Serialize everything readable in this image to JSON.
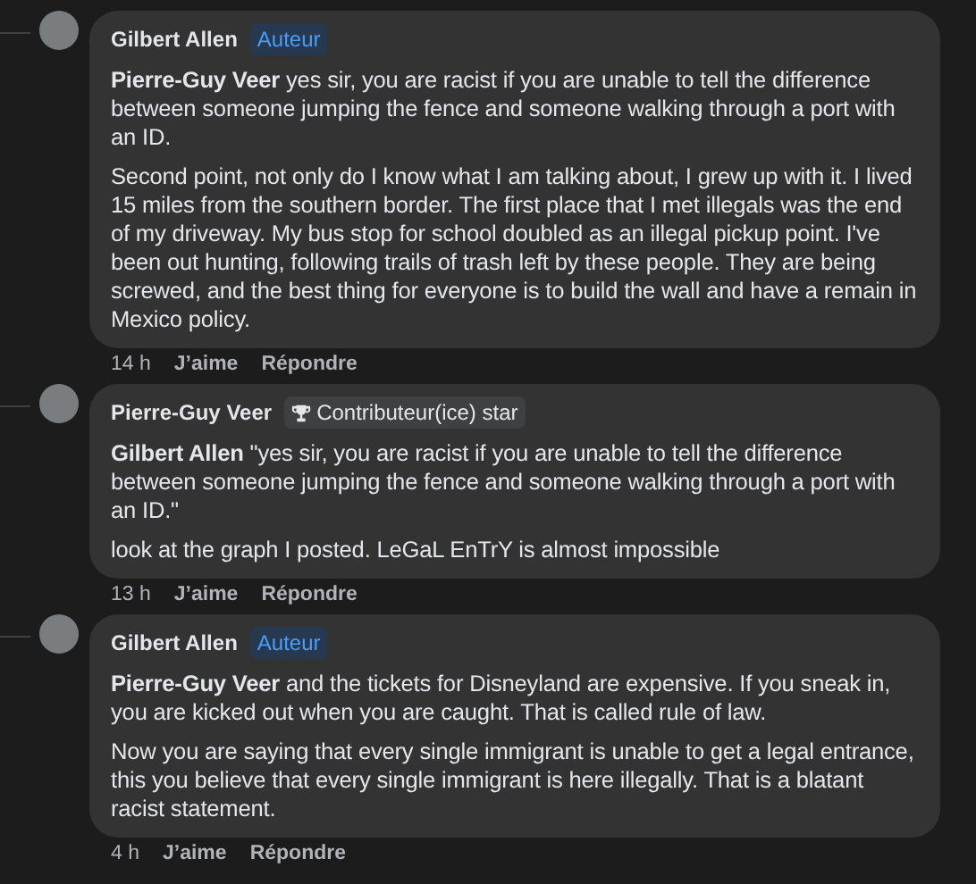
{
  "comments": [
    {
      "author": "Gilbert Allen",
      "badge": {
        "kind": "author",
        "label": "Auteur"
      },
      "paragraphs": [
        "**Pierre-Guy Veer** yes sir, you are racist if you are unable to tell the difference between someone jumping the fence and someone walking through a port with an ID.",
        "Second point, not only do I know what I am talking about, I grew up with it. I lived 15 miles from the southern border. The first place that I met illegals was the end of my driveway. My bus stop for school doubled as an illegal pickup point. I've been out hunting, following trails of trash left by these people. They are being screwed, and the best thing for everyone is to build the wall and have a remain in Mexico policy."
      ],
      "time": "14 h",
      "like": "J’aime",
      "reply": "Répondre"
    },
    {
      "author": "Pierre-Guy Veer",
      "badge": {
        "kind": "contributor",
        "label": "Contributeur(ice) star"
      },
      "paragraphs": [
        "**Gilbert Allen** \"yes sir, you are racist if you are unable to tell the difference between someone jumping the fence and someone walking through a port with an ID.\"",
        "look at the graph I posted. LeGaL EnTrY is almost impossible"
      ],
      "time": "13 h",
      "like": "J’aime",
      "reply": "Répondre"
    },
    {
      "author": "Gilbert Allen",
      "badge": {
        "kind": "author",
        "label": "Auteur"
      },
      "paragraphs": [
        "**Pierre-Guy Veer** and the tickets for Disneyland are expensive. If you sneak in, you are kicked out when you are caught. That is called rule of law.",
        "Now you are saying that every single immigrant is unable to get a legal entrance, this you believe that every single immigrant is here illegally. That is a blatant racist statement."
      ],
      "time": "4 h",
      "like": "J’aime",
      "reply": "Répondre"
    }
  ]
}
